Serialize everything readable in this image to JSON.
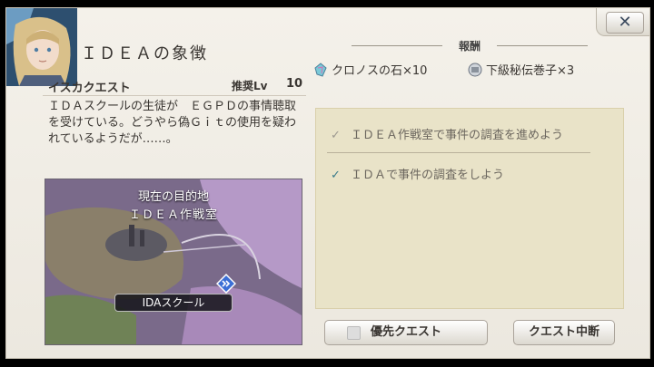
{
  "quest": {
    "title": "ＩＤＥＡの象徴",
    "type": "イスカクエスト",
    "recommended_label": "推奨Lv",
    "recommended_level": "10",
    "description": "ＩＤＡスクールの生徒が　ＥＧＰＤの事情聴取を受けている。どうやら偽Ｇｉｔの使用を疑われているようだが……。"
  },
  "map": {
    "caption": "現在の目的地",
    "destination": "ＩＤＥＡ作戦室",
    "location_label": "IDAスクール"
  },
  "rewards": {
    "title": "報酬",
    "items": [
      {
        "name": "クロノスの石×10",
        "icon": "chronos-stone-icon"
      },
      {
        "name": "下級秘伝巻子×3",
        "icon": "scroll-icon"
      }
    ]
  },
  "objectives": [
    {
      "text": "ＩＤＥＡ作戦室で事件の調査を進めよう",
      "active": false
    },
    {
      "text": "ＩＤＡで事件の調査をしよう",
      "active": true
    }
  ],
  "buttons": {
    "close": "✕",
    "priority": "優先クエスト",
    "suspend": "クエスト中断"
  },
  "colors": {
    "panel": "#f0ede6",
    "objective_bg": "#e9e3c8",
    "check_active": "#3a7a8a"
  }
}
